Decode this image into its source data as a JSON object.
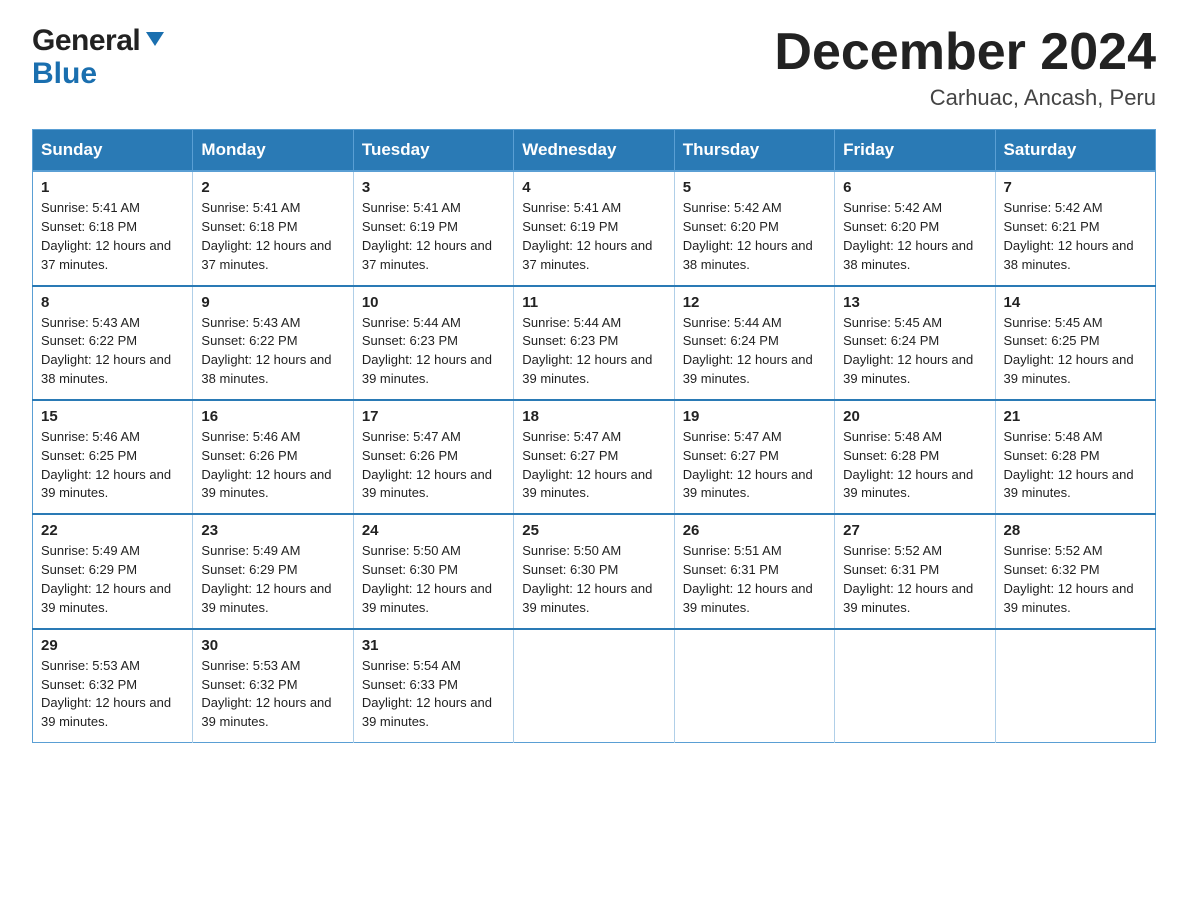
{
  "logo": {
    "general": "General",
    "blue": "Blue"
  },
  "title": "December 2024",
  "subtitle": "Carhuac, Ancash, Peru",
  "header": {
    "days": [
      "Sunday",
      "Monday",
      "Tuesday",
      "Wednesday",
      "Thursday",
      "Friday",
      "Saturday"
    ]
  },
  "weeks": [
    [
      {
        "day": "1",
        "sunrise": "5:41 AM",
        "sunset": "6:18 PM",
        "daylight": "12 hours and 37 minutes."
      },
      {
        "day": "2",
        "sunrise": "5:41 AM",
        "sunset": "6:18 PM",
        "daylight": "12 hours and 37 minutes."
      },
      {
        "day": "3",
        "sunrise": "5:41 AM",
        "sunset": "6:19 PM",
        "daylight": "12 hours and 37 minutes."
      },
      {
        "day": "4",
        "sunrise": "5:41 AM",
        "sunset": "6:19 PM",
        "daylight": "12 hours and 37 minutes."
      },
      {
        "day": "5",
        "sunrise": "5:42 AM",
        "sunset": "6:20 PM",
        "daylight": "12 hours and 38 minutes."
      },
      {
        "day": "6",
        "sunrise": "5:42 AM",
        "sunset": "6:20 PM",
        "daylight": "12 hours and 38 minutes."
      },
      {
        "day": "7",
        "sunrise": "5:42 AM",
        "sunset": "6:21 PM",
        "daylight": "12 hours and 38 minutes."
      }
    ],
    [
      {
        "day": "8",
        "sunrise": "5:43 AM",
        "sunset": "6:22 PM",
        "daylight": "12 hours and 38 minutes."
      },
      {
        "day": "9",
        "sunrise": "5:43 AM",
        "sunset": "6:22 PM",
        "daylight": "12 hours and 38 minutes."
      },
      {
        "day": "10",
        "sunrise": "5:44 AM",
        "sunset": "6:23 PM",
        "daylight": "12 hours and 39 minutes."
      },
      {
        "day": "11",
        "sunrise": "5:44 AM",
        "sunset": "6:23 PM",
        "daylight": "12 hours and 39 minutes."
      },
      {
        "day": "12",
        "sunrise": "5:44 AM",
        "sunset": "6:24 PM",
        "daylight": "12 hours and 39 minutes."
      },
      {
        "day": "13",
        "sunrise": "5:45 AM",
        "sunset": "6:24 PM",
        "daylight": "12 hours and 39 minutes."
      },
      {
        "day": "14",
        "sunrise": "5:45 AM",
        "sunset": "6:25 PM",
        "daylight": "12 hours and 39 minutes."
      }
    ],
    [
      {
        "day": "15",
        "sunrise": "5:46 AM",
        "sunset": "6:25 PM",
        "daylight": "12 hours and 39 minutes."
      },
      {
        "day": "16",
        "sunrise": "5:46 AM",
        "sunset": "6:26 PM",
        "daylight": "12 hours and 39 minutes."
      },
      {
        "day": "17",
        "sunrise": "5:47 AM",
        "sunset": "6:26 PM",
        "daylight": "12 hours and 39 minutes."
      },
      {
        "day": "18",
        "sunrise": "5:47 AM",
        "sunset": "6:27 PM",
        "daylight": "12 hours and 39 minutes."
      },
      {
        "day": "19",
        "sunrise": "5:47 AM",
        "sunset": "6:27 PM",
        "daylight": "12 hours and 39 minutes."
      },
      {
        "day": "20",
        "sunrise": "5:48 AM",
        "sunset": "6:28 PM",
        "daylight": "12 hours and 39 minutes."
      },
      {
        "day": "21",
        "sunrise": "5:48 AM",
        "sunset": "6:28 PM",
        "daylight": "12 hours and 39 minutes."
      }
    ],
    [
      {
        "day": "22",
        "sunrise": "5:49 AM",
        "sunset": "6:29 PM",
        "daylight": "12 hours and 39 minutes."
      },
      {
        "day": "23",
        "sunrise": "5:49 AM",
        "sunset": "6:29 PM",
        "daylight": "12 hours and 39 minutes."
      },
      {
        "day": "24",
        "sunrise": "5:50 AM",
        "sunset": "6:30 PM",
        "daylight": "12 hours and 39 minutes."
      },
      {
        "day": "25",
        "sunrise": "5:50 AM",
        "sunset": "6:30 PM",
        "daylight": "12 hours and 39 minutes."
      },
      {
        "day": "26",
        "sunrise": "5:51 AM",
        "sunset": "6:31 PM",
        "daylight": "12 hours and 39 minutes."
      },
      {
        "day": "27",
        "sunrise": "5:52 AM",
        "sunset": "6:31 PM",
        "daylight": "12 hours and 39 minutes."
      },
      {
        "day": "28",
        "sunrise": "5:52 AM",
        "sunset": "6:32 PM",
        "daylight": "12 hours and 39 minutes."
      }
    ],
    [
      {
        "day": "29",
        "sunrise": "5:53 AM",
        "sunset": "6:32 PM",
        "daylight": "12 hours and 39 minutes."
      },
      {
        "day": "30",
        "sunrise": "5:53 AM",
        "sunset": "6:32 PM",
        "daylight": "12 hours and 39 minutes."
      },
      {
        "day": "31",
        "sunrise": "5:54 AM",
        "sunset": "6:33 PM",
        "daylight": "12 hours and 39 minutes."
      },
      null,
      null,
      null,
      null
    ]
  ],
  "labels": {
    "sunrise": "Sunrise: ",
    "sunset": "Sunset: ",
    "daylight": "Daylight: "
  }
}
